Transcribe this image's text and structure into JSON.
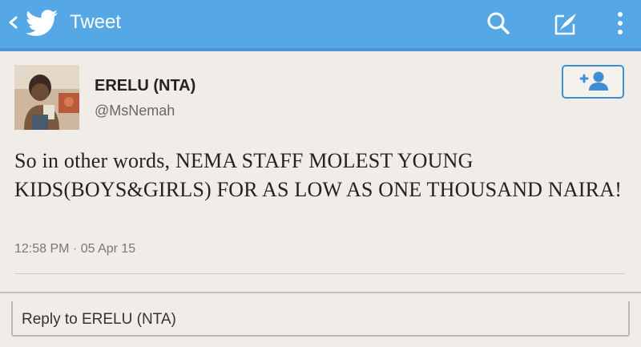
{
  "app_bar": {
    "title": "Tweet",
    "background_color": "#55a7e6",
    "icons": [
      "chevron-left-icon",
      "twitter-bird-icon",
      "search-icon",
      "compose-icon",
      "more-vertical-icon"
    ]
  },
  "tweet": {
    "author_name": "ERELU (NTA)",
    "author_handle": "@MsNemah",
    "text": "So in other words, NEMA STAFF MOLEST YOUNG KIDS(BOYS&GIRLS) FOR AS LOW AS ONE THOUSAND NAIRA!",
    "timestamp": "12:58 PM · 05 Apr 15",
    "follow_icon": "add-user-icon"
  },
  "reply": {
    "label": "Reply to ERELU (NTA)"
  }
}
